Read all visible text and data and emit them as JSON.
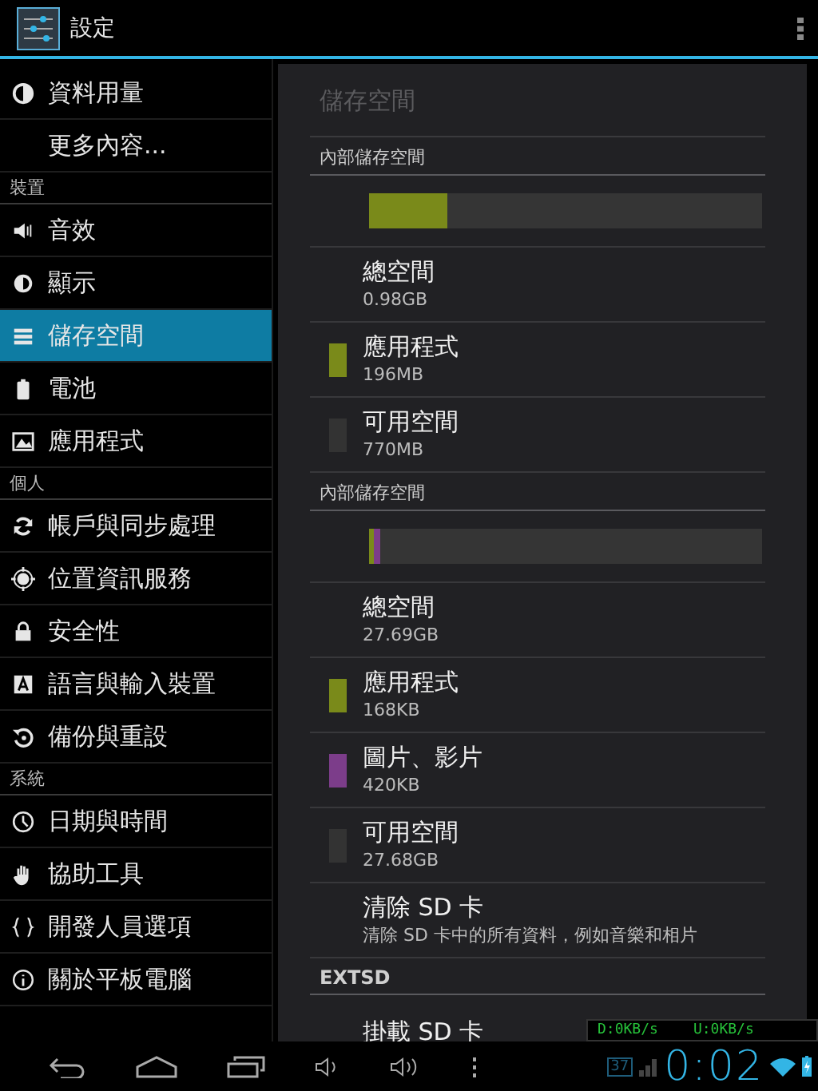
{
  "action_bar": {
    "title": "設定"
  },
  "sidebar": {
    "groups": [
      {
        "items": [
          {
            "label": "資料用量",
            "selected": false
          },
          {
            "label": "更多內容...",
            "selected": false
          }
        ]
      },
      {
        "header": "裝置",
        "items": [
          {
            "label": "音效",
            "selected": false
          },
          {
            "label": "顯示",
            "selected": false
          },
          {
            "label": "儲存空間",
            "selected": true
          },
          {
            "label": "電池",
            "selected": false
          },
          {
            "label": "應用程式",
            "selected": false
          }
        ]
      },
      {
        "header": "個人",
        "items": [
          {
            "label": "帳戶與同步處理",
            "selected": false
          },
          {
            "label": "位置資訊服務",
            "selected": false
          },
          {
            "label": "安全性",
            "selected": false
          },
          {
            "label": "語言與輸入裝置",
            "selected": false
          },
          {
            "label": "備份與重設",
            "selected": false
          }
        ]
      },
      {
        "header": "系統",
        "items": [
          {
            "label": "日期與時間",
            "selected": false
          },
          {
            "label": "協助工具",
            "selected": false
          },
          {
            "label": "開發人員選項",
            "selected": false
          },
          {
            "label": "關於平板電腦",
            "selected": false
          }
        ]
      }
    ]
  },
  "content": {
    "title": "儲存空間",
    "sections": [
      {
        "header": "內部儲存空間",
        "bar": [
          {
            "color": "#7a8a1a",
            "level": 0.2
          }
        ],
        "rows": [
          {
            "label": "總空間",
            "value": "0.98GB"
          },
          {
            "label": "應用程式",
            "value": "196MB",
            "color": "#7a8a1a"
          },
          {
            "label": "可用空間",
            "value": "770MB",
            "color": "#333333"
          }
        ]
      },
      {
        "header": "內部儲存空間",
        "bar": [
          {
            "color": "#7a8a1a",
            "level": 0.012
          },
          {
            "color": "#7c3d8a",
            "level": 0.015
          }
        ],
        "rows": [
          {
            "label": "總空間",
            "value": "27.69GB"
          },
          {
            "label": "應用程式",
            "value": "168KB",
            "color": "#7a8a1a"
          },
          {
            "label": "圖片、影片",
            "value": "420KB",
            "color": "#7c3d8a"
          },
          {
            "label": "可用空間",
            "value": "27.68GB",
            "color": "#333333"
          },
          {
            "label": "清除 SD 卡",
            "value": "清除 SD 卡中的所有資料，例如音樂和相片"
          }
        ]
      },
      {
        "header": "EXTSD",
        "rows": [
          {
            "label": "掛載 SD 卡"
          }
        ]
      }
    ]
  },
  "net_speed": {
    "down": "D:0KB/s",
    "up": "U:0KB/s"
  },
  "status_bar": {
    "badge": "37",
    "time": "0:02"
  }
}
